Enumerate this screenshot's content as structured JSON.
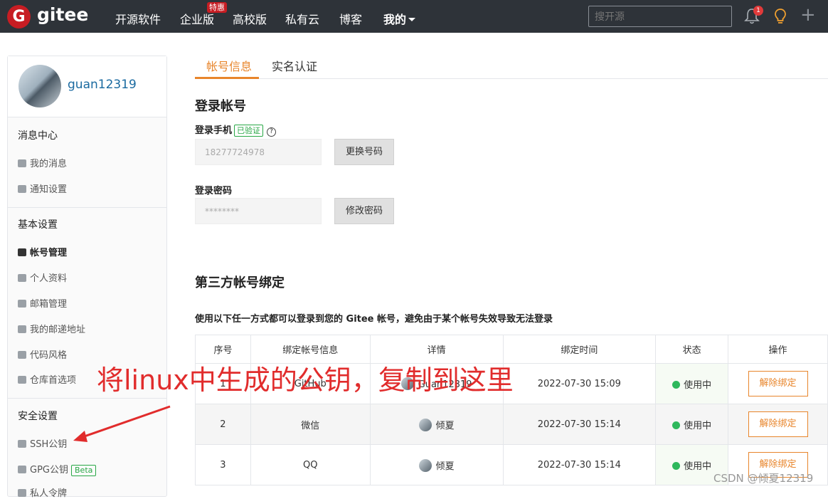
{
  "topnav": {
    "logo_letter": "G",
    "brand": "gitee",
    "items": [
      "开源软件",
      "企业版",
      "高校版",
      "私有云",
      "博客",
      "我的"
    ],
    "badge": "特惠",
    "search_placeholder": "搜开源",
    "notification_count": "1",
    "plus": "+"
  },
  "sidebar": {
    "username": "guan12319",
    "sections": [
      {
        "title": "消息中心",
        "items": [
          "我的消息",
          "通知设置"
        ]
      },
      {
        "title": "基本设置",
        "items": [
          "帐号管理",
          "个人资料",
          "邮箱管理",
          "我的邮递地址",
          "代码风格",
          "仓库首选项"
        ]
      },
      {
        "title": "安全设置",
        "items": [
          "SSH公钥",
          "GPG公钥",
          "私人令牌"
        ]
      }
    ],
    "gpg_badge": "Beta",
    "active_item": "帐号管理"
  },
  "tabs": [
    "帐号信息",
    "实名认证"
  ],
  "login": {
    "title": "登录帐号",
    "phone_label": "登录手机",
    "verified": "已验证",
    "help": "?",
    "phone_value": "18277724978",
    "change_phone": "更换号码",
    "password_label": "登录密码",
    "password_value": "********",
    "change_password": "修改密码"
  },
  "third_party": {
    "title": "第三方帐号绑定",
    "description": "使用以下任一方式都可以登录到您的 Gitee 帐号，避免由于某个帐号失效导致无法登录",
    "headers": [
      "序号",
      "绑定帐号信息",
      "详情",
      "绑定时间",
      "状态",
      "操作"
    ],
    "rows": [
      {
        "no": "1",
        "account": "GitHub",
        "detail": "Guan12319",
        "time": "2022-07-30 15:09",
        "status": "使用中",
        "action": "解除绑定"
      },
      {
        "no": "2",
        "account": "微信",
        "detail": "倾夏",
        "time": "2022-07-30 15:14",
        "status": "使用中",
        "action": "解除绑定"
      },
      {
        "no": "3",
        "account": "QQ",
        "detail": "倾夏",
        "time": "2022-07-30 15:14",
        "status": "使用中",
        "action": "解除绑定"
      }
    ]
  },
  "annotation": "将linux中生成的公钥，复制到这里",
  "watermark": "CSDN @倾夏12319",
  "colors": {
    "nav_bg": "#2e3339",
    "accent": "#e8852b",
    "brand_red": "#c71d23",
    "annotation_red": "#e12c2c",
    "ok_green": "#2eb85c"
  }
}
